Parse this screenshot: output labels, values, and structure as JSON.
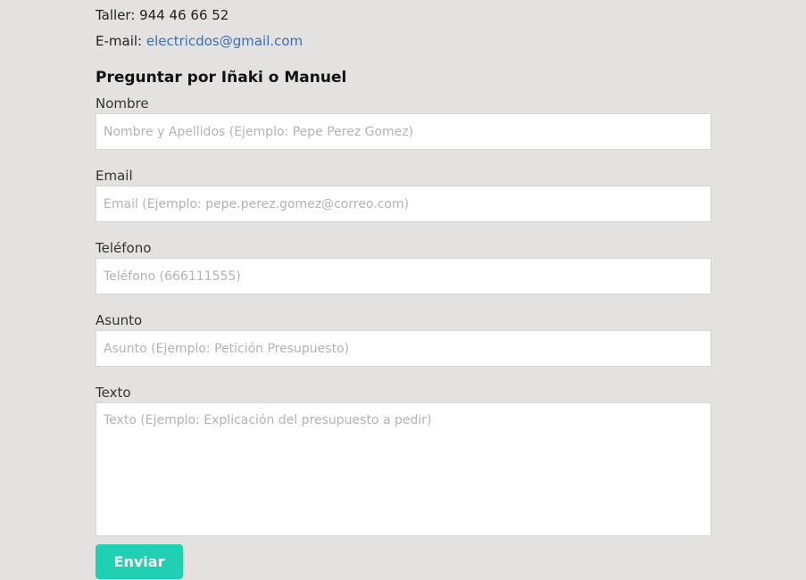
{
  "contact": {
    "taller_label": "Taller: 944 46 66 52",
    "email_prefix": "E-mail: ",
    "email_link": "electricdos@gmail.com"
  },
  "form": {
    "title": "Preguntar por Iñaki o Manuel",
    "fields": [
      {
        "label": "Nombre",
        "placeholder": "Nombre y Apellidos (Ejemplo: Pepe Perez Gomez)"
      },
      {
        "label": "Email",
        "placeholder": "Email (Ejemplo: pepe.perez.gomez@correo.com)"
      },
      {
        "label": "Teléfono",
        "placeholder": "Teléfono (666111555)"
      },
      {
        "label": "Asunto",
        "placeholder": "Asunto (Ejemplo: Petición Presupuesto)"
      },
      {
        "label": "Texto",
        "placeholder": "Texto (Ejemplo: Explicación del presupuesto a pedir)"
      }
    ],
    "submit_label": "Enviar",
    "colors": {
      "submit_bg": "#1fd0b2",
      "link": "#3a6fb0",
      "page_bg": "#e4e2e1"
    }
  }
}
